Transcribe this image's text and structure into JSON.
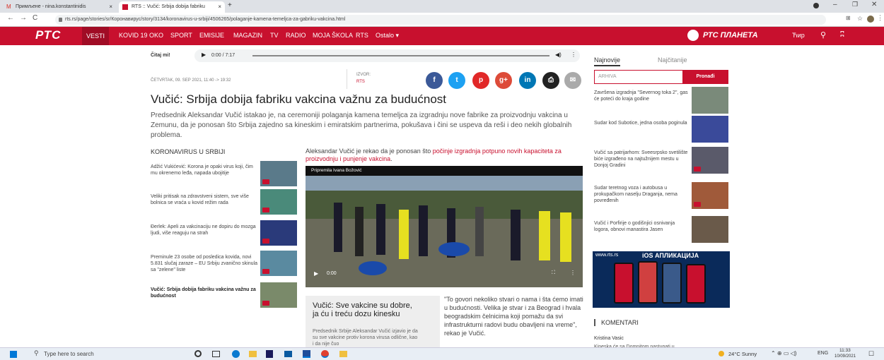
{
  "browser": {
    "tabs": [
      {
        "label": "Примљене - nina.konstantinidis",
        "close": "×"
      },
      {
        "label": "RTS :: Vučić: Srbija dobija fabriku",
        "close": "×"
      }
    ],
    "new_tab": "+",
    "url": "rts.rs/page/stories/sr/Коронавирус/story/3134/koronavirus-u-srbiji/4506265/polaganje-kamena-temeljca-za-gabriku-vakcina.html"
  },
  "site": {
    "logo": "РТС",
    "nav": [
      "VESTI",
      "KOVID 19",
      "OKO",
      "SPORT",
      "EMISIJE",
      "MAGAZIN",
      "TV",
      "RADIO",
      "MOJA ŠKOLA",
      "RTS",
      "Ostalo"
    ],
    "planeta": "РТС ПЛАНЕТА",
    "script_toggle": "Ћир"
  },
  "audio": {
    "label": "Čitaj mi!",
    "time": "0:00 / 7:17"
  },
  "article": {
    "date": "ČETVRTAK, 09. SEP 2021, 11:40 -> 19:32",
    "source_label": "IZVOR:",
    "source": "RTS",
    "title": "Vučić: Srbija dobija fabriku vakcina važnu za budućnost",
    "lead": "Predsednik Aleksandar Vučić istakao je, na ceremoniji polaganja kamena temeljca za izgradnju nove fabrike za proizvodnju vakcina u Zemunu, da je ponosan što Srbija zajedno sa kineskim i emiratskim partnerima, pokušava i čini se uspeva da reši i deo nekih globalnih problema.",
    "video_caption_plain": "Aleksandar Vučić je rekao da je ponosan što ",
    "video_caption_highlight": "počinje izgradnja potpuno novih kapaciteta za proizvodnju i punjenje vakcina",
    "video_caption_end": ".",
    "video_title": "Pripremila Ivana Božović",
    "video_time": "0:00",
    "subbox_title": "Vučić: Sve vakcine su dobre, ja ću i treću dozu kinesku",
    "subbox_text": "Predsednik Srbije Aleksandar Vučić izjavio je da su sve vakcine protiv korona virusa odlične, kao i da nije čuo",
    "quote": "\"To govori nekoliko stvari o nama i šta ćemo imati u budućnosti. Velika je stvar i za Beograd i hvala beogradskim čelnicima koji pomažu da svi infrastrukturni radovi budu obavljeni na vreme\", rekao je Vučić."
  },
  "related": {
    "heading": "KORONAVIRUS U SRBIJI",
    "items": [
      "Adžić Vukićević: Korona je opaki virus koji, čim mu okrenemo leđa, napada ubojitije",
      "Veliki pritisak na zdravstveni sistem, sve više bolnica se vraća u kovid režim rada",
      "Đerlek: Apeli za vakcinaciju ne dopiru do mozga ljudi, više reaguju na strah",
      "Preminule 23 osobe od posledica kovida, novi 5.831 slučaj zaraze – EU Srbiju zvanično skinula sa \"zelene\" liste",
      "Vučić: Srbija dobija fabriku vakcina važnu za budućnost"
    ]
  },
  "sidebar": {
    "tabs": [
      "Najnovije",
      "Najčitanije"
    ],
    "search_placeholder": "ARHIVA",
    "search_button": "Pronađi",
    "items": [
      "Završena izgradnja \"Severnog toka 2\", gas će poteći do kraja godine",
      "Sudar kod Subotice, jedna osoba poginula",
      "Vučić sa patrijarhom: Sveesrpsko svetilište biće izgrađeno na najtužnijem mestu u Donjoj Gradini",
      "Sudar teretnog voza i autobusa u prokupačkom naselju Draganja, nema povređenih",
      "Vučić i Porfirije o godišnjici osnivanja logora, obnovi manastira Jasen"
    ],
    "ad_site": "www.rts.rs",
    "ad_title": "iOS АПЛИКАЦИЈА",
    "comments_heading": "KOMENTARI",
    "comment_author": "Kristina Vasic",
    "comment_text": "Kineska će sa Domnitom nastupati u"
  },
  "taskbar": {
    "search": "Type here to search",
    "weather": "24°C Sunny",
    "lang": "ENG",
    "time": "11:33",
    "date": "10/09/2021"
  },
  "colors": {
    "brand": "#c8102e"
  }
}
